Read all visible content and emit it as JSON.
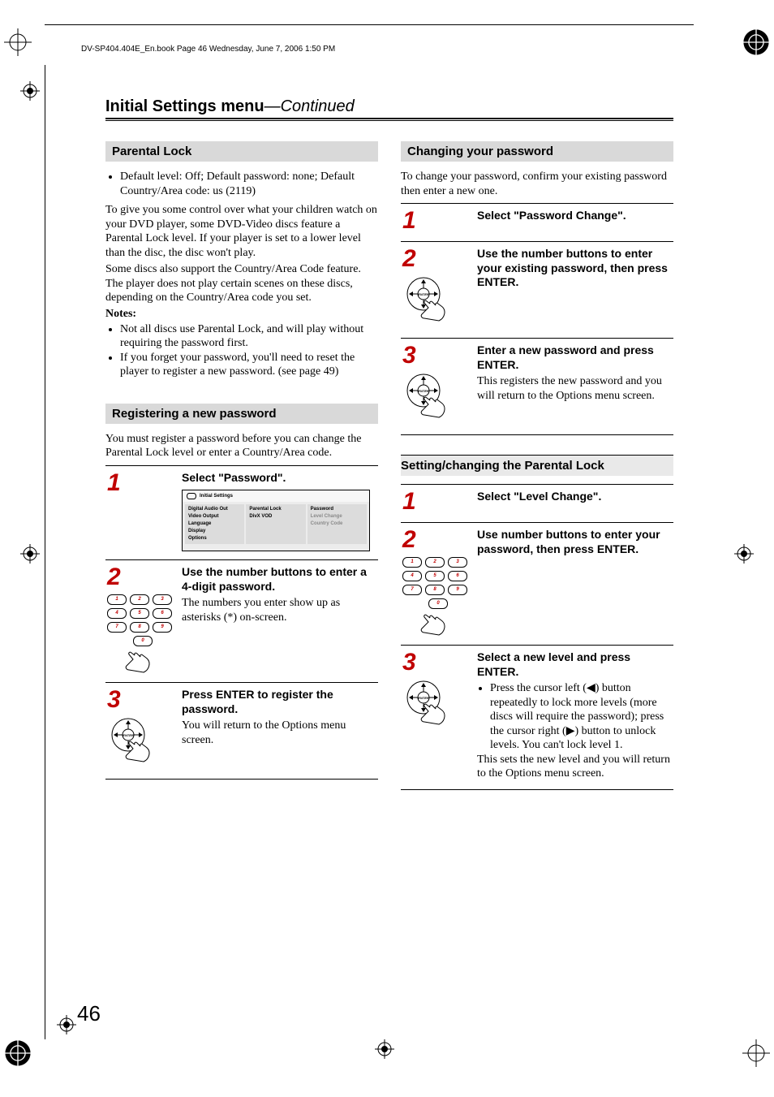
{
  "meta": {
    "hdr_line": "DV-SP404.404E_En.book  Page 46  Wednesday, June 7, 2006  1:50 PM",
    "page_number": "46",
    "section_title": "Initial Settings menu",
    "section_title_cont": "—Continued"
  },
  "left": {
    "h_parental": "Parental Lock",
    "bullet_default": "Default level: Off; Default password: none; Default Country/Area code: us (2119)",
    "p1": "To give you some control over what your children watch on your DVD player, some DVD-Video discs feature a Parental Lock level. If your player is set to a lower level than the disc, the disc won't play.",
    "p2": "Some discs also support the Country/Area Code feature. The player does not play certain scenes on these discs, depending on the Country/Area code you set.",
    "notes_label": "Notes:",
    "note1": "Not all discs use Parental Lock, and will play without requiring the password first.",
    "note2": "If you forget your password, you'll need to reset the player to register a new password. (see page 49)",
    "h_register": "Registering a new password",
    "register_intro": "You must register a password before you can change the Parental Lock level or enter a Country/Area code.",
    "steps": {
      "s1": {
        "num": "1",
        "bold": "Select \"Password\"."
      },
      "s2": {
        "num": "2",
        "bold": "Use the number buttons to enter a 4-digit password.",
        "body": "The numbers you enter show up as asterisks (*) on-screen."
      },
      "s3": {
        "num": "3",
        "bold": "Press ENTER to register the password.",
        "body": "You will return to the Options menu screen."
      }
    },
    "menu": {
      "title": "Initial Settings",
      "c1": [
        "Digital Audio Out",
        "Video Output",
        "Language",
        "Display",
        "Options"
      ],
      "c2": [
        "Parental Lock",
        "DivX VOD"
      ],
      "c3": [
        "Password",
        "Level Change",
        "Country Code"
      ]
    }
  },
  "right": {
    "h_change": "Changing your password",
    "change_intro": "To change your password, confirm your existing password then enter a new one.",
    "change_steps": {
      "s1": {
        "num": "1",
        "bold": "Select \"Password Change\"."
      },
      "s2": {
        "num": "2",
        "bold": "Use the number buttons to enter your existing password, then press ENTER."
      },
      "s3": {
        "num": "3",
        "bold": "Enter a new password and press ENTER.",
        "body": "This registers the new password and you will return to the Options menu screen."
      }
    },
    "h_setpl": "Setting/changing the Parental Lock",
    "pl_steps": {
      "s1": {
        "num": "1",
        "bold": "Select \"Level Change\"."
      },
      "s2": {
        "num": "2",
        "bold": "Use number buttons to enter your password, then press ENTER."
      },
      "s3": {
        "num": "3",
        "bold": "Select a new level and press ENTER.",
        "li": "Press the cursor left (◀) button repeatedly to lock more levels (more discs will require the password); press the cursor right (▶) button to unlock levels. You can't lock level 1.",
        "body2": "This sets the new level and you will return to the Options menu screen."
      }
    }
  },
  "keypad": {
    "1": "1",
    "2": "2",
    "3": "3",
    "4": "4",
    "5": "5",
    "6": "6",
    "7": "7",
    "8": "8",
    "9": "9",
    "0": "0"
  }
}
